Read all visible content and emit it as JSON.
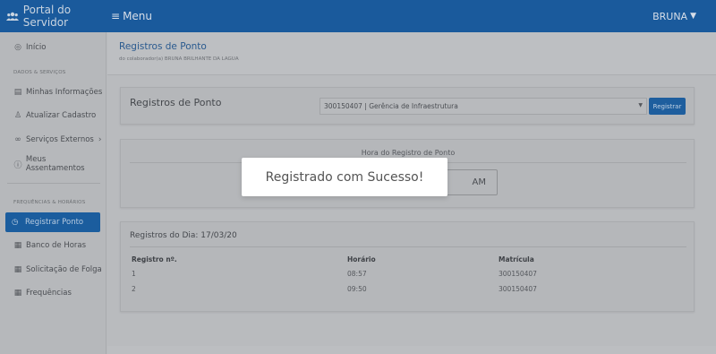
{
  "topbar": {
    "brand_label": "Portal do Servidor",
    "brand_icon": "users-icon",
    "menu_label": "Menu",
    "menu_icon": "hamburger-icon",
    "user_name": "BRUNA",
    "bg_color": "#1a5a9c"
  },
  "sidebar": {
    "items": [
      {
        "label": "Início",
        "icon": "home-icon"
      },
      {
        "label": "Minhas Informações",
        "icon": "id-card-icon"
      },
      {
        "label": "Atualizar Cadastro",
        "icon": "user-edit-icon"
      },
      {
        "label": "Serviços Externos",
        "icon": "link-icon"
      },
      {
        "label": "Meus Assentamentos",
        "icon": "info-icon"
      },
      {
        "label": "Registrar Ponto",
        "icon": "clock-icon",
        "active": true
      },
      {
        "label": "Banco de Horas",
        "icon": "calendar-icon"
      },
      {
        "label": "Solicitação de Folga",
        "icon": "calendar-icon"
      },
      {
        "label": "Frequências",
        "icon": "calendar-check-icon"
      }
    ],
    "sections": {
      "dados": "DADOS & SERVIÇOS",
      "frequencias": "FREQUÊNCIAS & HORÁRIOS"
    }
  },
  "page": {
    "title": "Registros de Ponto",
    "subtitle": "do colaborador(a) BRUNA BRILHANTE DA LAGUA"
  },
  "registro_card": {
    "title": "Registros de Ponto",
    "select_value": "300150407 | Gerência de Infraestrutura",
    "button_label": "Registrar"
  },
  "hora_card": {
    "label": "Hora do Registro de Ponto",
    "clock_value": "AM"
  },
  "dia_card": {
    "title": "Registros do Dia: 17/03/20",
    "columns": [
      "Registro nº.",
      "Horário",
      "Matrícula"
    ],
    "rows": [
      [
        "1",
        "08:57",
        "300150407"
      ],
      [
        "2",
        "09:50",
        "300150407"
      ]
    ]
  },
  "toast": {
    "message": "Registrado com Sucesso!"
  }
}
